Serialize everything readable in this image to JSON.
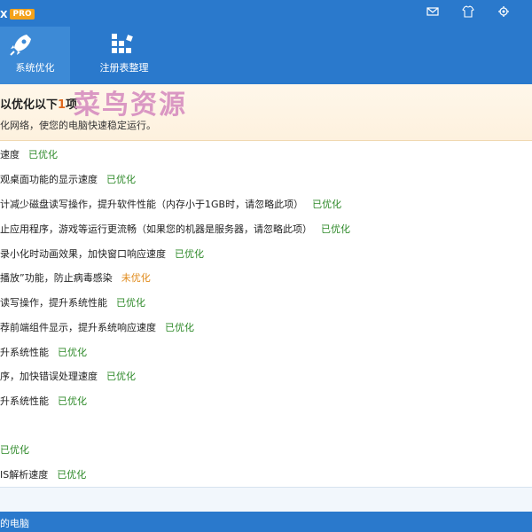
{
  "app": {
    "brand_fragment": "X",
    "pro_badge": "PRO"
  },
  "window_controls": [
    {
      "name": "mail-icon"
    },
    {
      "name": "skin-icon"
    },
    {
      "name": "settings-icon"
    }
  ],
  "tabs": [
    {
      "label": "系统优化",
      "icon": "rocket-icon",
      "active": true
    },
    {
      "label": "注册表整理",
      "icon": "registry-grid-icon",
      "active": false
    }
  ],
  "banner": {
    "title_prefix": "以优化以下",
    "count": "1",
    "title_suffix": "项",
    "subtitle": "化网络，使您的电脑快速稳定运行。"
  },
  "watermark": "菜鸟资源",
  "rows": [
    {
      "text": "速度",
      "status": "已优化",
      "ok": true
    },
    {
      "text": "观桌面功能的显示速度",
      "status": "已优化",
      "ok": true
    },
    {
      "text": "计减少磁盘读写操作，提升软件性能（内存小于1GB时，请忽略此项）",
      "status": "已优化",
      "ok": true
    },
    {
      "text": "止应用程序，游戏等运行更流畅（如果您的机器是服务器，请忽略此项）",
      "status": "已优化",
      "ok": true
    },
    {
      "text": "录小化时动画效果，加快窗口响应速度",
      "status": "已优化",
      "ok": true
    },
    {
      "text": "播放”功能，防止病毒感染",
      "status": "未优化",
      "ok": false
    },
    {
      "text": "读写操作，提升系统性能",
      "status": "已优化",
      "ok": true
    },
    {
      "text": "荐前端组件显示，提升系统响应速度",
      "status": "已优化",
      "ok": true
    },
    {
      "text": "升系统性能",
      "status": "已优化",
      "ok": true
    },
    {
      "text": "序，加快错误处理速度",
      "status": "已优化",
      "ok": true
    },
    {
      "text": "升系统性能",
      "status": "已优化",
      "ok": true
    },
    {
      "text": "",
      "status": "已优化",
      "ok": true
    },
    {
      "text": "IS解析速度",
      "status": "已优化",
      "ok": true
    }
  ],
  "status_bar": {
    "text": "的电脑"
  },
  "colors": {
    "primary": "#2a79cc",
    "ok": "#2f8a2a",
    "warn": "#e08a1a",
    "accent": "#e06a1e"
  }
}
